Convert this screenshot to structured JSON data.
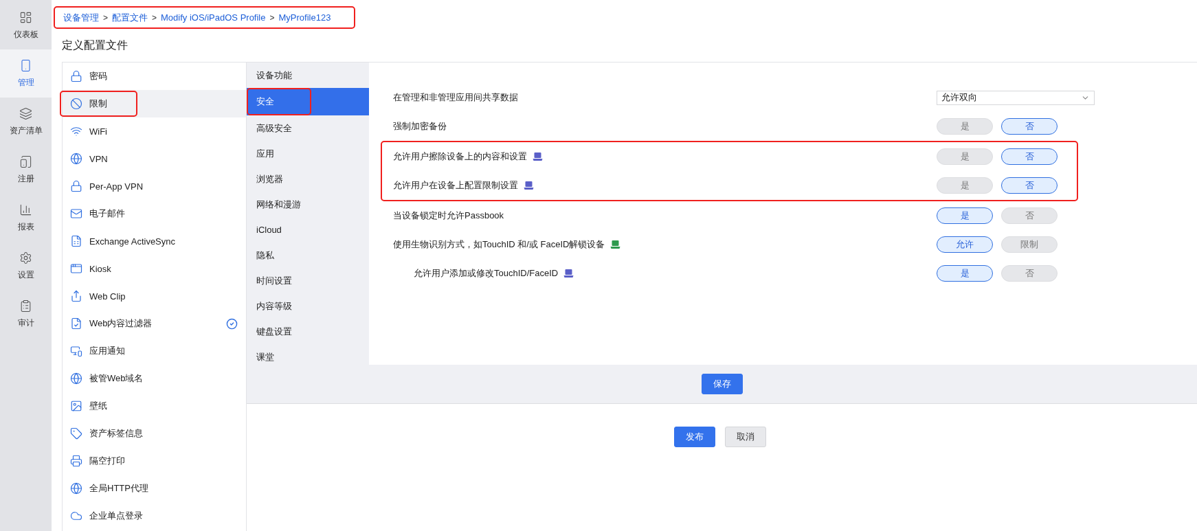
{
  "nav": [
    {
      "label": "仪表板",
      "selected": false
    },
    {
      "label": "管理",
      "selected": true
    },
    {
      "label": "资产清单",
      "selected": false
    },
    {
      "label": "注册",
      "selected": false
    },
    {
      "label": "报表",
      "selected": false
    },
    {
      "label": "设置",
      "selected": false
    },
    {
      "label": "审计",
      "selected": false
    }
  ],
  "breadcrumb": {
    "highlighted": true,
    "items": [
      "设备管理",
      "配置文件",
      "Modify iOS/iPadOS Profile",
      "MyProfile123"
    ],
    "separator": ">"
  },
  "title": "定义配置文件",
  "payloads": [
    {
      "label": "密码",
      "selected": false,
      "highlighted": false,
      "configured": false
    },
    {
      "label": "限制",
      "selected": true,
      "highlighted": true,
      "configured": false
    },
    {
      "label": "WiFi",
      "selected": false,
      "highlighted": false,
      "configured": false
    },
    {
      "label": "VPN",
      "selected": false,
      "highlighted": false,
      "configured": false
    },
    {
      "label": "Per-App VPN",
      "selected": false,
      "highlighted": false,
      "configured": false
    },
    {
      "label": "电子邮件",
      "selected": false,
      "highlighted": false,
      "configured": false
    },
    {
      "label": "Exchange ActiveSync",
      "selected": false,
      "highlighted": false,
      "configured": false
    },
    {
      "label": "Kiosk",
      "selected": false,
      "highlighted": false,
      "configured": false
    },
    {
      "label": "Web Clip",
      "selected": false,
      "highlighted": false,
      "configured": false
    },
    {
      "label": "Web内容过滤器",
      "selected": false,
      "highlighted": false,
      "configured": true
    },
    {
      "label": "应用通知",
      "selected": false,
      "highlighted": false,
      "configured": false
    },
    {
      "label": "被管Web域名",
      "selected": false,
      "highlighted": false,
      "configured": false
    },
    {
      "label": "壁纸",
      "selected": false,
      "highlighted": false,
      "configured": false
    },
    {
      "label": "资产标签信息",
      "selected": false,
      "highlighted": false,
      "configured": false
    },
    {
      "label": "隔空打印",
      "selected": false,
      "highlighted": false,
      "configured": false
    },
    {
      "label": "全局HTTP代理",
      "selected": false,
      "highlighted": false,
      "configured": false
    },
    {
      "label": "企业单点登录",
      "selected": false,
      "highlighted": false,
      "configured": false
    }
  ],
  "sections": [
    {
      "label": "设备功能",
      "selected": false,
      "highlighted": false
    },
    {
      "label": "安全",
      "selected": true,
      "highlighted": true
    },
    {
      "label": "高级安全",
      "selected": false,
      "highlighted": false
    },
    {
      "label": "应用",
      "selected": false,
      "highlighted": false
    },
    {
      "label": "浏览器",
      "selected": false,
      "highlighted": false
    },
    {
      "label": "网络和漫游",
      "selected": false,
      "highlighted": false
    },
    {
      "label": "iCloud",
      "selected": false,
      "highlighted": false
    },
    {
      "label": "隐私",
      "selected": false,
      "highlighted": false
    },
    {
      "label": "时间设置",
      "selected": false,
      "highlighted": false
    },
    {
      "label": "内容等级",
      "selected": false,
      "highlighted": false
    },
    {
      "label": "键盘设置",
      "selected": false,
      "highlighted": false
    },
    {
      "label": "课堂",
      "selected": false,
      "highlighted": false
    }
  ],
  "settings": [
    {
      "label": "在管理和非管理应用间共享数据",
      "highlighted": false,
      "control": {
        "kind": "select",
        "value": "允许双向"
      }
    },
    {
      "label": "强制加密备份",
      "highlighted": false,
      "control": {
        "kind": "toggle",
        "options": [
          {
            "label": "是",
            "selected": false
          },
          {
            "label": "否",
            "selected": true
          }
        ]
      }
    },
    {
      "label": "允许用户擦除设备上的内容和设置",
      "highlighted": true,
      "tag": {
        "color": "#5a5fc8"
      },
      "control": {
        "kind": "toggle",
        "options": [
          {
            "label": "是",
            "selected": false
          },
          {
            "label": "否",
            "selected": true
          }
        ]
      }
    },
    {
      "label": "允许用户在设备上配置限制设置",
      "highlighted": true,
      "tag": {
        "color": "#5a5fc8"
      },
      "control": {
        "kind": "toggle",
        "options": [
          {
            "label": "是",
            "selected": false
          },
          {
            "label": "否",
            "selected": true
          }
        ]
      }
    },
    {
      "label": "当设备锁定时允许Passbook",
      "highlighted": false,
      "control": {
        "kind": "toggle",
        "options": [
          {
            "label": "是",
            "selected": true
          },
          {
            "label": "否",
            "selected": false
          }
        ]
      }
    },
    {
      "label": "使用生物识别方式，如TouchID 和/或 FaceID解锁设备",
      "highlighted": false,
      "tag": {
        "color": "#2e9a4e"
      },
      "control": {
        "kind": "toggle",
        "options": [
          {
            "label": "允许",
            "selected": true
          },
          {
            "label": "限制",
            "selected": false
          }
        ]
      },
      "children": [
        {
          "label": "允许用户添加或修改TouchID/FaceID",
          "highlighted": false,
          "tag": {
            "color": "#5a5fc8"
          },
          "control": {
            "kind": "toggle",
            "options": [
              {
                "label": "是",
                "selected": true
              },
              {
                "label": "否",
                "selected": false
              }
            ]
          }
        }
      ]
    }
  ],
  "save_button": "保存",
  "footer_buttons": [
    {
      "label": "发布",
      "kind": "primary"
    },
    {
      "label": "取消",
      "kind": "secondary"
    }
  ]
}
